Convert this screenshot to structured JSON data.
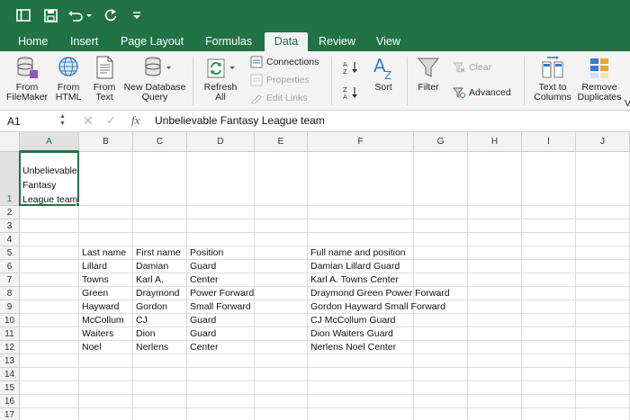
{
  "ribbon": {
    "tabs": [
      "Home",
      "Insert",
      "Page Layout",
      "Formulas",
      "Data",
      "Review",
      "View"
    ],
    "active_tab": "Data",
    "get_data": {
      "from_filemaker": [
        "From",
        "FileMaker"
      ],
      "from_html": [
        "From",
        "HTML"
      ],
      "from_text": [
        "From",
        "Text"
      ],
      "new_database_query": [
        "New Database",
        "Query"
      ]
    },
    "connections_group": {
      "refresh_all": [
        "Refresh",
        "All"
      ],
      "connections": "Connections",
      "properties": "Properties",
      "edit_links": "Edit Links"
    },
    "sort_filter": {
      "sort": "Sort",
      "filter": "Filter",
      "clear": "Clear",
      "advanced": "Advanced"
    },
    "data_tools": {
      "text_to_columns": [
        "Text to",
        "Columns"
      ],
      "remove_duplicates": [
        "Remove",
        "Duplicates"
      ],
      "cut_off_label": "V"
    }
  },
  "formula_bar": {
    "name_box": "A1",
    "fx_label": "fx",
    "content": "Unbelievable Fantasy League team"
  },
  "grid": {
    "columns": [
      "A",
      "B",
      "C",
      "D",
      "E",
      "F",
      "G",
      "H",
      "I",
      "J"
    ],
    "rows": [
      "1",
      "2",
      "3",
      "4",
      "5",
      "6",
      "7",
      "8",
      "9",
      "10",
      "11",
      "12",
      "13",
      "14",
      "15",
      "16",
      "17"
    ],
    "selected_cell": "A1",
    "a1_lines": [
      "Unbelievable",
      "Fantasy",
      "League team"
    ],
    "table": [
      [
        "Last name",
        "First name",
        "Position",
        "Full name and position"
      ],
      [
        "Lillard",
        "Damian",
        "Guard",
        "Damian Lillard Guard"
      ],
      [
        "Towns",
        "Karl A.",
        "Center",
        "Karl A. Towns Center"
      ],
      [
        "Green",
        "Draymond",
        "Power Forward",
        "Draymond Green Power Forward"
      ],
      [
        "Hayward",
        "Gordon",
        "Small Forward",
        "Gordon Hayward Small Forward"
      ],
      [
        "McCollum",
        "CJ",
        "Guard",
        "CJ McCollum Guard"
      ],
      [
        "Waiters",
        "Dion",
        "Guard",
        "Dion Waiters Guard"
      ],
      [
        "Noel",
        "Nerlens",
        "Center",
        "Nerlens Noel Center"
      ]
    ]
  },
  "colors": {
    "brand": "#217346",
    "ribbon_bg": "#f3f3f3",
    "gridline": "#dcdcdc"
  }
}
